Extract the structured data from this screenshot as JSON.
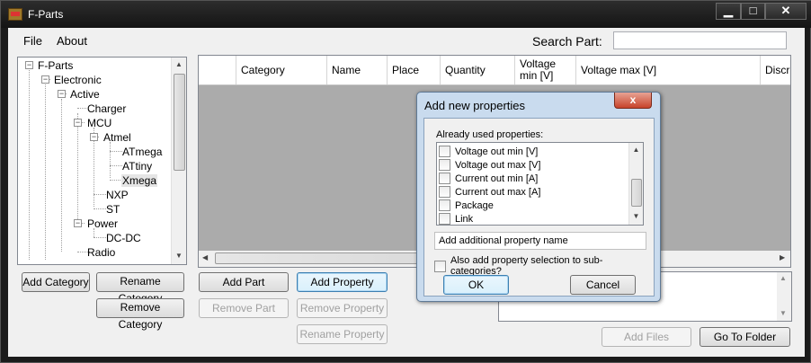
{
  "window": {
    "title": "F-Parts"
  },
  "menu": {
    "file": "File",
    "about": "About"
  },
  "search": {
    "label": "Search Part:",
    "value": "",
    "placeholder": ""
  },
  "tree": {
    "nodes": [
      {
        "label": "F-Parts",
        "box": "−"
      },
      {
        "label": "Electronic",
        "box": "−"
      },
      {
        "label": "Active",
        "box": "−"
      },
      {
        "label": "Charger"
      },
      {
        "label": "MCU",
        "box": "−"
      },
      {
        "label": "Atmel",
        "box": "−"
      },
      {
        "label": "ATmega"
      },
      {
        "label": "ATtiny"
      },
      {
        "label": "Xmega"
      },
      {
        "label": "NXP"
      },
      {
        "label": "ST"
      },
      {
        "label": "Power",
        "box": "−"
      },
      {
        "label": "DC-DC"
      },
      {
        "label": "Radio"
      }
    ]
  },
  "category_buttons": {
    "add": "Add Category",
    "rename": "Rename Category",
    "remove": "Remove Category"
  },
  "grid": {
    "columns": [
      "Category",
      "Name",
      "Place",
      "Quantity",
      "Voltage min [V]",
      "Voltage max [V]",
      "Discri"
    ]
  },
  "part_buttons": {
    "add_part": "Add Part",
    "add_property": "Add Property",
    "remove_part": "Remove Part",
    "remove_property": "Remove Property",
    "rename_property": "Rename Property",
    "add_files": "Add Files",
    "go_to_folder": "Go To Folder"
  },
  "dialog": {
    "title": "Add new properties",
    "close": "x",
    "already_label": "Already used properties:",
    "properties": [
      "Voltage out min [V]",
      "Voltage out max [V]",
      "Current out min [A]",
      "Current out max [A]",
      "Package",
      "Link"
    ],
    "new_property_value": "Add additional property name",
    "subcategories_label": "Also add property selection to sub-categories?",
    "ok": "OK",
    "cancel": "Cancel"
  }
}
